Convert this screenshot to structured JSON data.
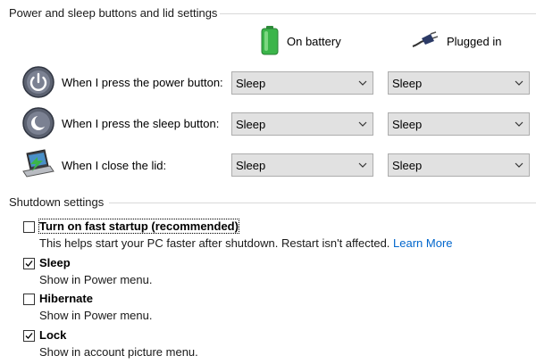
{
  "power_section": {
    "title": "Power and sleep buttons and lid settings",
    "columns": {
      "on_battery": "On battery",
      "plugged_in": "Plugged in"
    },
    "rows": [
      {
        "label": "When I press the power button:",
        "battery": "Sleep",
        "plugged": "Sleep",
        "icon": "power-button-icon"
      },
      {
        "label": "When I press the sleep button:",
        "battery": "Sleep",
        "plugged": "Sleep",
        "icon": "sleep-button-icon"
      },
      {
        "label": "When I close the lid:",
        "battery": "Sleep",
        "plugged": "Sleep",
        "icon": "laptop-lid-icon"
      }
    ]
  },
  "shutdown_section": {
    "title": "Shutdown settings",
    "options": [
      {
        "label": "Turn on fast startup (recommended)",
        "checked": false,
        "desc": "This helps start your PC faster after shutdown. Restart isn't affected. ",
        "link": "Learn More"
      },
      {
        "label": "Sleep",
        "checked": true,
        "desc": "Show in Power menu."
      },
      {
        "label": "Hibernate",
        "checked": false,
        "desc": "Show in Power menu."
      },
      {
        "label": "Lock",
        "checked": true,
        "desc": "Show in account picture menu."
      }
    ]
  },
  "colors": {
    "select_bg": "#e1e1e1",
    "link": "#0066cc",
    "battery_green": "#3bb54a"
  }
}
